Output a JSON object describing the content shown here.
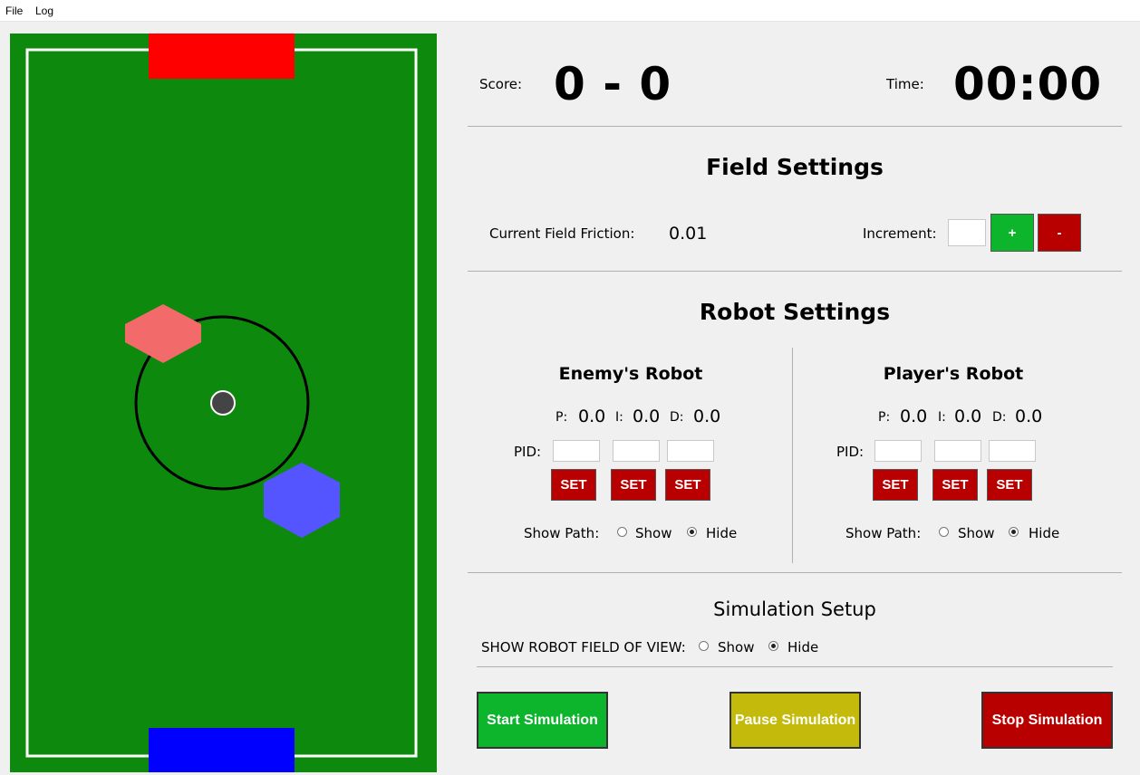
{
  "menu": {
    "file": "File",
    "log": "Log"
  },
  "score": {
    "label": "Score:",
    "value": "0 - 0"
  },
  "time": {
    "label": "Time:",
    "value": "00:00"
  },
  "field_settings": {
    "title": "Field Settings",
    "friction_label": "Current Field Friction:",
    "friction_value": "0.01",
    "increment_label": "Increment:",
    "increment_value": "",
    "plus_label": "+",
    "minus_label": "-"
  },
  "robot_settings": {
    "title": "Robot Settings",
    "enemy": {
      "title": "Enemy's Robot",
      "p_key": "P:",
      "p": "0.0",
      "i_key": "I:",
      "i": "0.0",
      "d_key": "D:",
      "d": "0.0",
      "pid_label": "PID:",
      "set_label": "SET",
      "show_path_label": "Show Path:",
      "show_label": "Show",
      "hide_label": "Hide",
      "selected": "Hide"
    },
    "player": {
      "title": "Player's Robot",
      "p_key": "P:",
      "p": "0.0",
      "i_key": "I:",
      "i": "0.0",
      "d_key": "D:",
      "d": "0.0",
      "pid_label": "PID:",
      "set_label": "SET",
      "show_path_label": "Show Path:",
      "show_label": "Show",
      "hide_label": "Hide",
      "selected": "Hide"
    }
  },
  "simulation_setup": {
    "title": "Simulation Setup",
    "fov_label": "SHOW ROBOT FIELD OF VIEW:",
    "show_label": "Show",
    "hide_label": "Hide",
    "selected": "Hide"
  },
  "buttons": {
    "start": "Start Simulation",
    "pause": "Pause Simulation",
    "stop": "Stop Simulation"
  },
  "colors": {
    "field": "#0d8a0d",
    "enemy_goal": "#ff0000",
    "player_goal": "#0000ff",
    "enemy_robot": "#f26a6a",
    "player_robot": "#5555ff",
    "ball": "#444444"
  }
}
